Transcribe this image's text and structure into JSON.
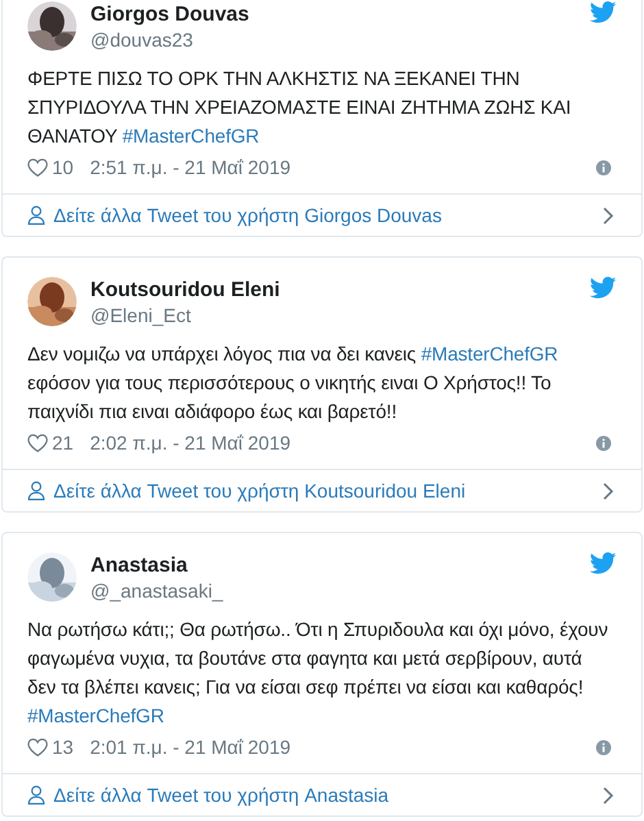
{
  "tweets": [
    {
      "name": "Giorgos Douvas",
      "handle": "@douvas23",
      "body": [
        {
          "kind": "text",
          "text": "ΦΕΡΤΕ ΠΙΣΩ ΤΟ ΟΡΚ ΤΗΝ ΑΛΚΗΣΤΙΣ ΝΑ ΞΕΚΑΝΕΙ ΤΗΝ ΣΠΥΡΙΔΟΥΛΑ ΤΗΝ ΧΡΕΙΑΖΟΜΑΣΤΕ ΕΙΝΑΙ ΖΗΤΗΜΑ ΖΩΗΣ ΚΑΙ ΘΑΝΑΤΟΥ"
        },
        {
          "kind": "hashtag",
          "text": "#MasterChefGR"
        }
      ],
      "likes": "10",
      "time": "2:51 π.μ. - 21 Μαΐ 2019",
      "footer": "Δείτε άλλα Tweet του χρήστη Giorgos Douvas"
    },
    {
      "name": "Koutsouridou Eleni",
      "handle": "@Eleni_Ect",
      "body": [
        {
          "kind": "text",
          "text": "Δεν νομιζω να υπάρχει λόγος πια να δει κανεις"
        },
        {
          "kind": "hashtag",
          "text": "#MasterChefGR"
        },
        {
          "kind": "text",
          "text": "εφόσον για τους περισσότερους ο νικητής ειναι Ο Χρήστος!! Το παιχνίδι πια ειναι αδιάφορο έως και βαρετό!!"
        }
      ],
      "likes": "21",
      "time": "2:02 π.μ. - 21 Μαΐ 2019",
      "footer": "Δείτε άλλα Tweet του χρήστη Koutsouridou Eleni"
    },
    {
      "name": "Anastasia",
      "handle": "@_anastasaki_",
      "body": [
        {
          "kind": "text",
          "text": "Να ρωτήσω κάτι;; Θα ρωτήσω.. Ότι η Σπυριδουλα και όχι μόνο, έχουν φαγωμένα νυχια, τα βουτάνε στα φαγητα και μετά σερβίρουν, αυτά δεν τα βλέπει κανεις; Για να είσαι σεφ πρέπει να είσαι και καθαρός!"
        },
        {
          "kind": "hashtag",
          "text": "#MasterChefGR"
        }
      ],
      "likes": "13",
      "time": "2:01 π.μ. - 21 Μαΐ 2019",
      "footer": "Δείτε άλλα Tweet του χρήστη Anastasia"
    }
  ]
}
